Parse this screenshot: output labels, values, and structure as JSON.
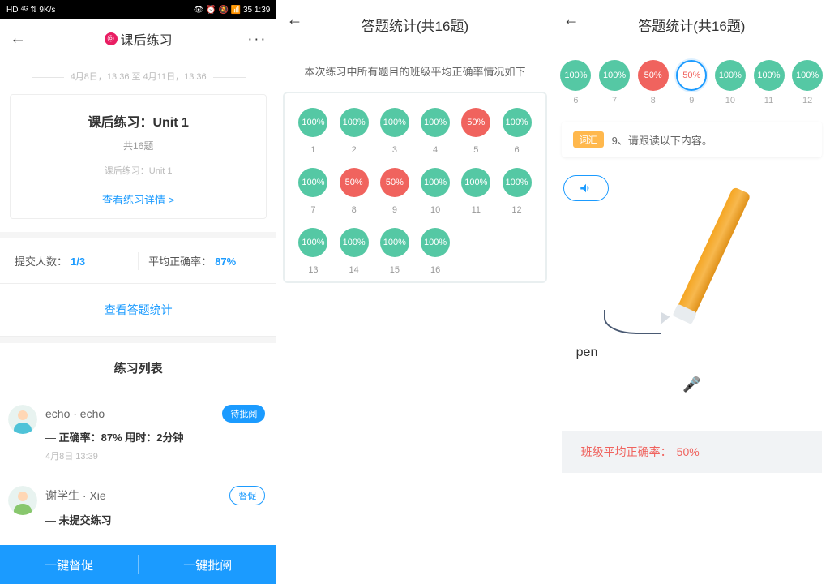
{
  "statusbar": {
    "left": "HD ⁴ᴳ ⇅ 9K/s",
    "right": "👁 ⏰ 🔕 📶 35 1:39"
  },
  "panel1": {
    "nav": {
      "title": "课后练习",
      "more": "···"
    },
    "date_range": "4月8日，13:36 至 4月11日，13:36",
    "card": {
      "title": "课后练习：Unit 1",
      "sub1": "共16题",
      "sub2": "课后练习：Unit 1",
      "link": "查看练习详情 >"
    },
    "stats": {
      "submitted_label": "提交人数：",
      "submitted_value": "1/3",
      "accuracy_label": "平均正确率：",
      "accuracy_value": "87%"
    },
    "answers_link": "查看答题统计",
    "list_title": "练习列表",
    "students": [
      {
        "name": "echo · echo",
        "badge": "待批阅",
        "badge_style": "fill",
        "line2": "正确率：87%  用时：2分钟",
        "line3": "4月8日 13:39"
      },
      {
        "name": "谢学生 · Xie",
        "badge": "督促",
        "badge_style": "outline",
        "line2": "未提交练习",
        "line3": ""
      }
    ],
    "bottom": {
      "left": "一键督促",
      "right": "一键批阅"
    }
  },
  "panel2": {
    "nav_title": "答题统计(共16题)",
    "caption": "本次练习中所有题目的班级平均正确率情况如下",
    "cells": [
      {
        "n": 1,
        "v": "100%",
        "c": "green"
      },
      {
        "n": 2,
        "v": "100%",
        "c": "green"
      },
      {
        "n": 3,
        "v": "100%",
        "c": "green"
      },
      {
        "n": 4,
        "v": "100%",
        "c": "green"
      },
      {
        "n": 5,
        "v": "50%",
        "c": "red"
      },
      {
        "n": 6,
        "v": "100%",
        "c": "green"
      },
      {
        "n": 7,
        "v": "100%",
        "c": "green"
      },
      {
        "n": 8,
        "v": "50%",
        "c": "red"
      },
      {
        "n": 9,
        "v": "50%",
        "c": "red"
      },
      {
        "n": 10,
        "v": "100%",
        "c": "green"
      },
      {
        "n": 11,
        "v": "100%",
        "c": "green"
      },
      {
        "n": 12,
        "v": "100%",
        "c": "green"
      },
      {
        "n": 13,
        "v": "100%",
        "c": "green"
      },
      {
        "n": 14,
        "v": "100%",
        "c": "green"
      },
      {
        "n": 15,
        "v": "100%",
        "c": "green"
      },
      {
        "n": 16,
        "v": "100%",
        "c": "green"
      }
    ]
  },
  "panel3": {
    "nav_title": "答题统计(共16题)",
    "strip": [
      {
        "n": 6,
        "v": "100%",
        "c": "green"
      },
      {
        "n": 7,
        "v": "100%",
        "c": "green"
      },
      {
        "n": 8,
        "v": "50%",
        "c": "red"
      },
      {
        "n": 9,
        "v": "50%",
        "c": "sel"
      },
      {
        "n": 10,
        "v": "100%",
        "c": "green"
      },
      {
        "n": 11,
        "v": "100%",
        "c": "green"
      },
      {
        "n": 12,
        "v": "100%",
        "c": "green"
      }
    ],
    "question": {
      "tag": "词汇",
      "text": "9、请跟读以下内容。"
    },
    "word": "pen",
    "class_rate_label": "班级平均正确率：",
    "class_rate_value": "50%"
  }
}
